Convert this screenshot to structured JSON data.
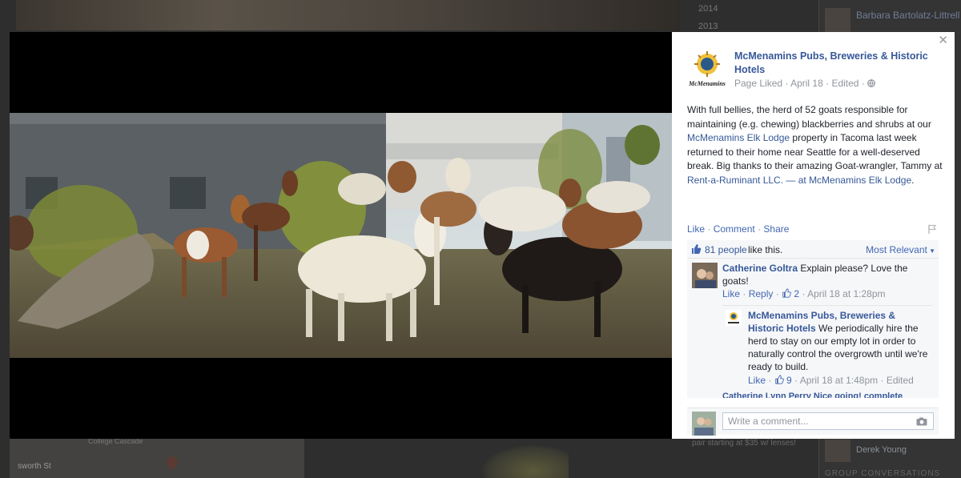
{
  "background": {
    "years": [
      "2014",
      "2013"
    ],
    "friend_top": "Barbara Bartolatz-Littrell likes Emma Marion",
    "friend_bottom": "Derek Young",
    "group_label": "GROUP CONVERSATIONS",
    "map_label_street": "College Cascade",
    "map_label_place": "sworth St",
    "under_text": "pair starting at $35 w/ lenses!"
  },
  "post": {
    "page_name": "McMenamins Pubs, Breweries & Historic Hotels",
    "logo_caption": "McMenamins",
    "meta": {
      "status": "Page Liked",
      "date": "April 18",
      "edited": "Edited"
    },
    "text": {
      "part1": "With full bellies, the herd of 52 goats responsible for maintaining (e.g. chewing) blackberries and shrubs at our ",
      "link1": "McMenamins Elk Lodge",
      "part2": " property in Tacoma last week returned to their home near Seattle for a well-deserved break. Big thanks to their amazing Goat-wrangler, Tammy at ",
      "link2": "Rent-a-Ruminant LLC",
      "part3": ". — at ",
      "link3": "McMenamins Elk Lodge",
      "part4": "."
    },
    "actions": {
      "like": "Like",
      "comment": "Comment",
      "share": "Share"
    },
    "likes": {
      "count": "81 people",
      "suffix": "like this.",
      "sort": "Most Relevant"
    }
  },
  "comments": [
    {
      "author": "Catherine Goltra",
      "text": "Explain please? Love the goats!",
      "like": "Like",
      "reply": "Reply",
      "likes": "2",
      "time": "April 18 at 1:28pm"
    },
    {
      "author": "McMenamins Pubs, Breweries & Historic Hotels",
      "text": "We periodically hire the herd to stay on our empty lot in order to naturally control the overgrowth until we're ready to build.",
      "like": "Like",
      "likes": "9",
      "time": "April 18 at 1:48pm",
      "edited": "Edited"
    }
  ],
  "next_comment": "Catherine Lynn Perry Nice going! complete",
  "composer": {
    "placeholder": "Write a comment..."
  },
  "colors": {
    "link": "#365899",
    "action": "#4267b2",
    "muted": "#90949c",
    "panel_bg": "#ffffff"
  },
  "icons": [
    "close-icon",
    "globe-icon",
    "flag-icon",
    "like-thumb-icon",
    "camera-icon"
  ]
}
